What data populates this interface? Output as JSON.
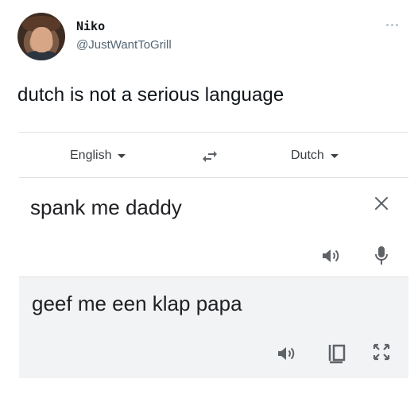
{
  "tweet": {
    "author_name": "Niko",
    "author_handle": "@JustWantToGrill",
    "text": "dutch is not a serious language"
  },
  "translate": {
    "source_language": "English",
    "target_language": "Dutch",
    "source_text": "spank me daddy",
    "translated_text": "geef me een klap papa"
  },
  "icons": {
    "more": "more-dots-icon",
    "swap": "swap-languages-icon",
    "clear": "close-icon",
    "listen": "speaker-icon",
    "mic": "microphone-icon",
    "copy": "copy-icon",
    "expand": "fullscreen-icon"
  },
  "colors": {
    "text_primary": "#0f1419",
    "handle_gray": "#536471",
    "icon_gray": "#5f6368",
    "result_bg": "#f1f3f4"
  }
}
